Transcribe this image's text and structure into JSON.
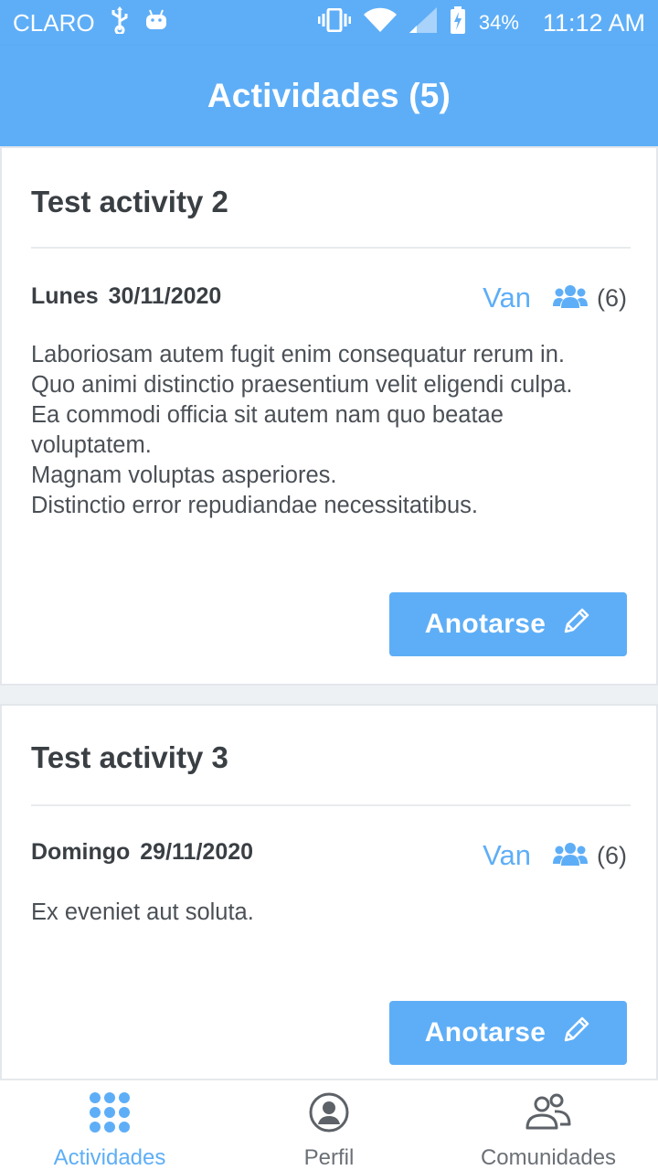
{
  "status_bar": {
    "carrier": "CLARO",
    "battery": "34%",
    "time": "11:12 AM",
    "icons": [
      "usb-icon",
      "android-icon",
      "vibrate-icon",
      "wifi-icon",
      "signal-icon",
      "battery-icon"
    ]
  },
  "header": {
    "title": "Actividades (5)"
  },
  "activities": [
    {
      "title": "Test activity 2",
      "day": "Lunes",
      "date": "30/11/2020",
      "going_label": "Van",
      "going_count": "(6)",
      "description": [
        "Laboriosam autem fugit enim consequatur rerum in.",
        "Quo animi distinctio praesentium velit eligendi culpa.",
        "Ea commodi officia sit autem nam quo beatae voluptatem.",
        "Magnam voluptas asperiores.",
        "Distinctio error repudiandae necessitatibus."
      ],
      "button_label": "Anotarse"
    },
    {
      "title": "Test activity 3",
      "day": "Domingo",
      "date": "29/11/2020",
      "going_label": "Van",
      "going_count": "(6)",
      "description": [
        "Ex eveniet aut soluta."
      ],
      "button_label": "Anotarse"
    }
  ],
  "bottom_nav": [
    {
      "label": "Actividades",
      "icon": "grid-icon",
      "active": true
    },
    {
      "label": "Perfil",
      "icon": "profile-icon",
      "active": false
    },
    {
      "label": "Comunidades",
      "icon": "communities-icon",
      "active": false
    }
  ],
  "colors": {
    "accent": "#5eaef7",
    "text": "#3a3f44",
    "muted": "#6b7076"
  }
}
